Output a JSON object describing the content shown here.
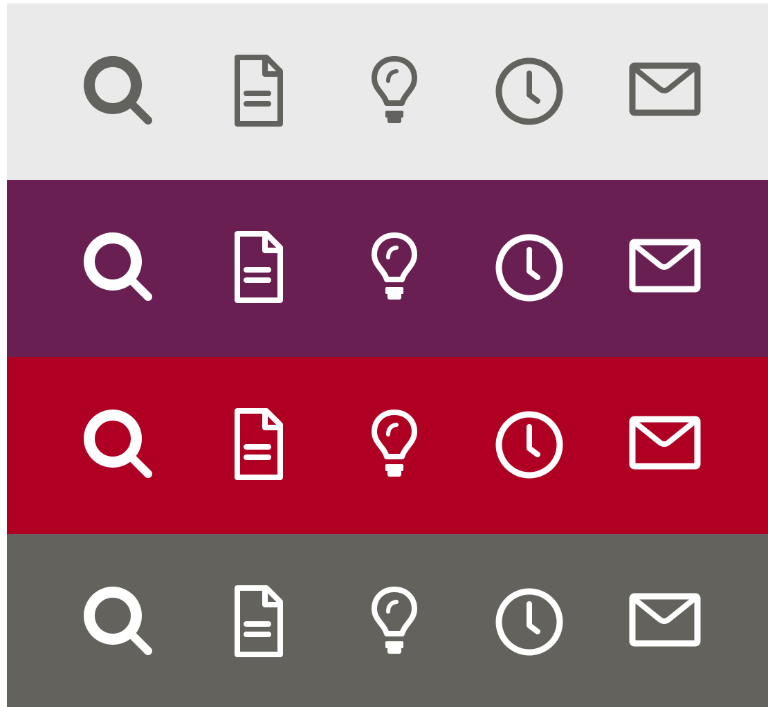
{
  "rows": [
    {
      "name": "light-gray",
      "background": "#eaeaea",
      "icon_color": "#62625e"
    },
    {
      "name": "purple",
      "background": "#6a1f53",
      "icon_color": "#ffffff"
    },
    {
      "name": "crimson",
      "background": "#af0024",
      "icon_color": "#ffffff"
    },
    {
      "name": "dark-gray",
      "background": "#63625d",
      "icon_color": "#ffffff"
    }
  ],
  "icons": [
    "search-icon",
    "document-icon",
    "lightbulb-icon",
    "clock-icon",
    "envelope-icon"
  ]
}
